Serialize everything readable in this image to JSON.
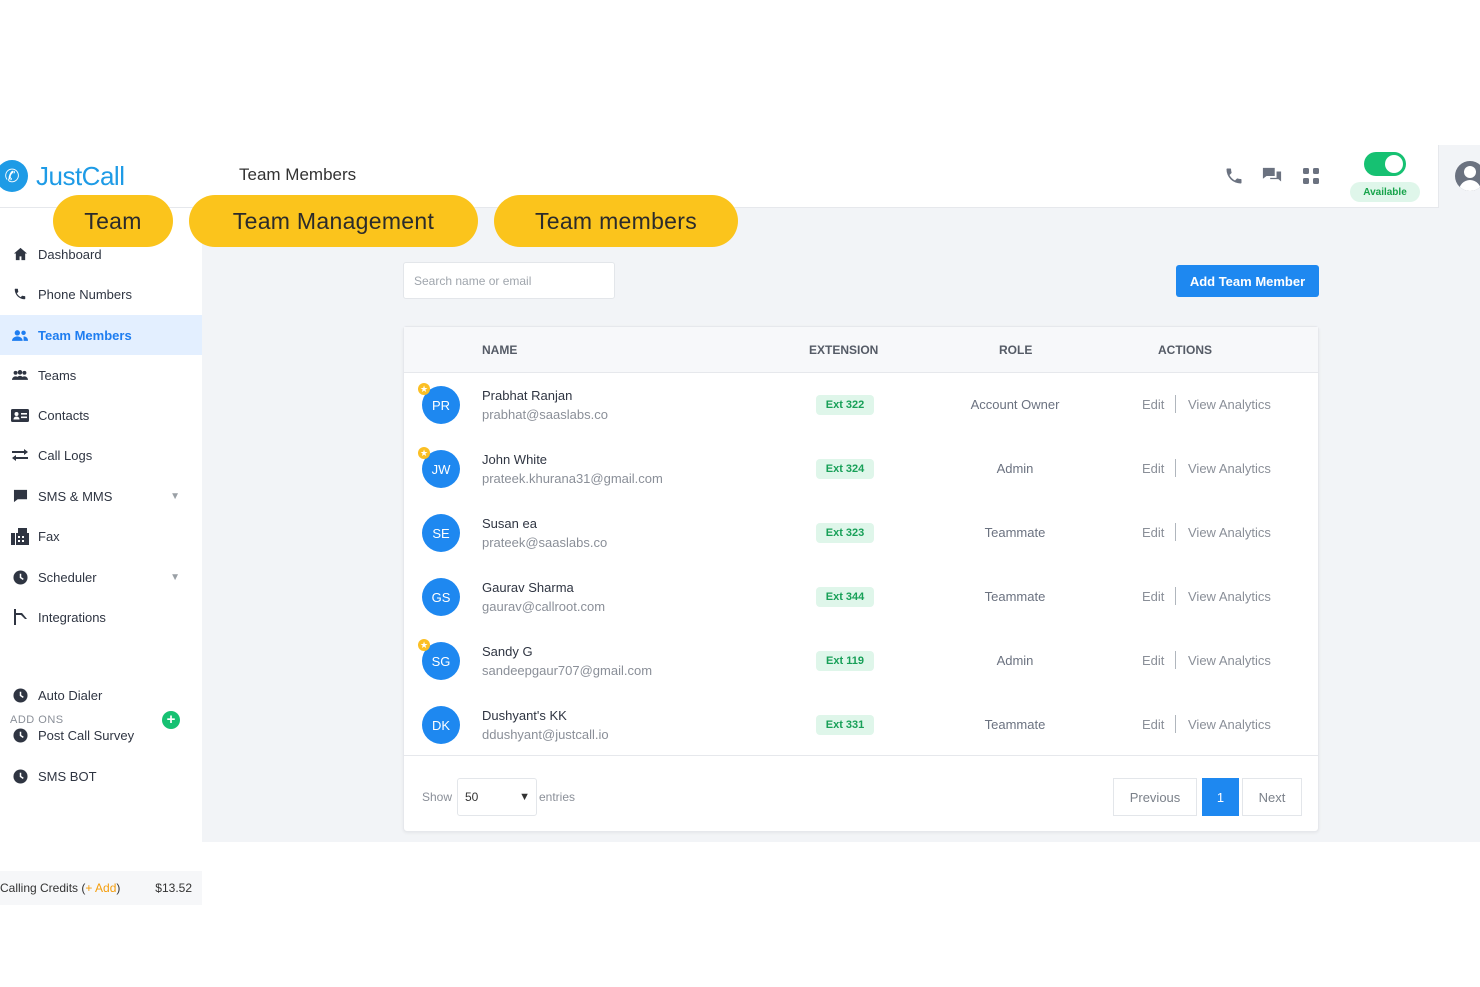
{
  "app": {
    "logo_text": "JustCall",
    "page_title": "Team Members",
    "status_label": "Available"
  },
  "annotations": [
    "Team",
    "Team Management",
    "Team members"
  ],
  "sidebar": {
    "items": [
      {
        "label": "Dashboard",
        "icon": "home-icon"
      },
      {
        "label": "Phone Numbers",
        "icon": "phone-icon"
      },
      {
        "label": "Team Members",
        "icon": "team-members-icon",
        "active": true
      },
      {
        "label": "Teams",
        "icon": "teams-icon"
      },
      {
        "label": "Contacts",
        "icon": "contacts-icon"
      },
      {
        "label": "Call Logs",
        "icon": "call-logs-icon"
      },
      {
        "label": "SMS & MMS",
        "icon": "sms-icon",
        "expandable": true
      },
      {
        "label": "Fax",
        "icon": "fax-icon"
      },
      {
        "label": "Scheduler",
        "icon": "scheduler-icon",
        "expandable": true
      },
      {
        "label": "Integrations",
        "icon": "integrations-icon"
      }
    ],
    "addons_label": "ADD ONS",
    "addons": [
      {
        "label": "Auto Dialer"
      },
      {
        "label": "Post Call Survey"
      },
      {
        "label": "SMS BOT"
      }
    ],
    "credits_label": "Calling Credits (",
    "credits_add": "+ Add",
    "credits_close": ")",
    "credits_amount": "$13.52"
  },
  "search": {
    "placeholder": "Search name or email"
  },
  "add_button": "Add Team Member",
  "table": {
    "headers": {
      "name": "NAME",
      "extension": "EXTENSION",
      "role": "ROLE",
      "actions": "ACTIONS"
    },
    "rows": [
      {
        "initials": "PR",
        "name": "Prabhat Ranjan",
        "email": "prabhat@saaslabs.co",
        "ext": "Ext 322",
        "role": "Account Owner",
        "starred": true
      },
      {
        "initials": "JW",
        "name": "John White",
        "email": "prateek.khurana31@gmail.com",
        "ext": "Ext 324",
        "role": "Admin",
        "starred": true
      },
      {
        "initials": "SE",
        "name": "Susan ea",
        "email": "prateek@saaslabs.co",
        "ext": "Ext 323",
        "role": "Teammate",
        "starred": false
      },
      {
        "initials": "GS",
        "name": "Gaurav Sharma",
        "email": "gaurav@callroot.com",
        "ext": "Ext 344",
        "role": "Teammate",
        "starred": false
      },
      {
        "initials": "SG",
        "name": "Sandy G",
        "email": "sandeepgaur707@gmail.com",
        "ext": "Ext 119",
        "role": "Admin",
        "starred": true
      },
      {
        "initials": "DK",
        "name": "Dushyant's KK",
        "email": "ddushyant@justcall.io",
        "ext": "Ext 331",
        "role": "Teammate",
        "starred": false
      }
    ],
    "edit_label": "Edit",
    "analytics_label": "View Analytics"
  },
  "footer": {
    "show_label": "Show",
    "show_value": "50",
    "entries_label": "entries",
    "prev_label": "Previous",
    "current_page": "1",
    "next_label": "Next"
  },
  "colors": {
    "brand": "#1e9be6",
    "primary_button": "#1e88f0",
    "available_green": "#16c172",
    "annotation_yellow": "#fbc41c"
  }
}
